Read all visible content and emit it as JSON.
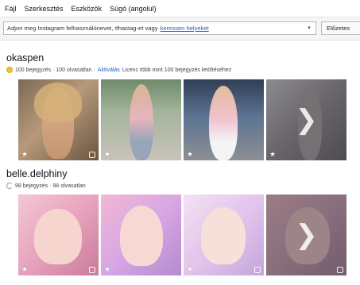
{
  "menu": [
    "Fájl",
    "Szerkesztés",
    "Eszközök",
    "Súgó (angolul)"
  ],
  "search": {
    "placeholder": "Adjon meg Instagram felhasználónevet, #hastag-et vagy",
    "link": "keressen helyeket"
  },
  "preview_button": "Előzetes",
  "accounts": [
    {
      "name": "okaspen",
      "stats": "100 bejegyzés · 100 olvasatlan ·",
      "activate": "Aktiválás",
      "license": "Licenc több mint 100 bejegyzés letöltéséhez",
      "status_icon": "warning-icon"
    },
    {
      "name": "belle.delphiny",
      "stats": "98 bejegyzés · 98 olvasatlan",
      "status_icon": "loading-icon"
    }
  ],
  "icons": {
    "star": "★",
    "next": "❯"
  },
  "colors": {
    "link": "#1a5fcf",
    "warning": "#f1c232"
  }
}
